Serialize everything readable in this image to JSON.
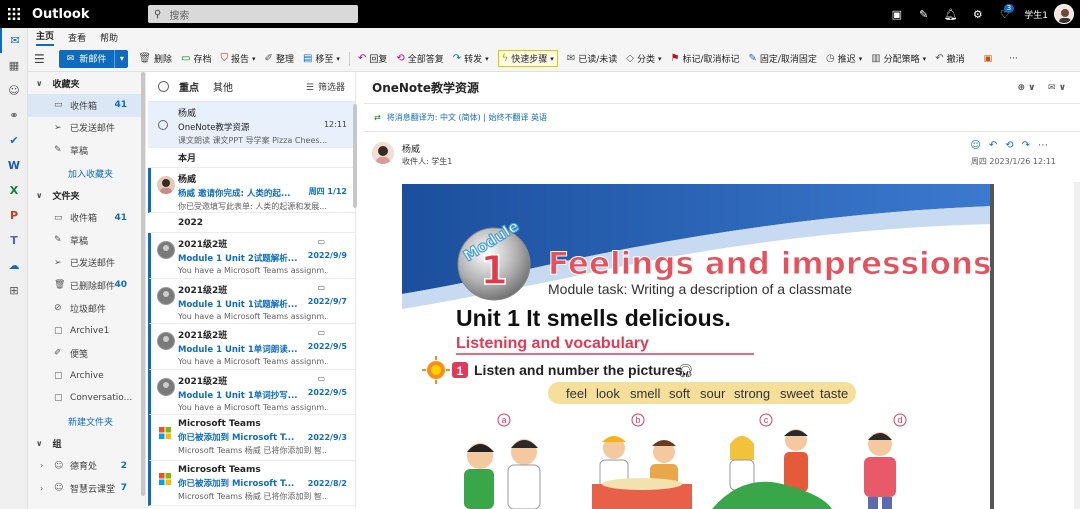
{
  "titlebar": {
    "app_name": "Outlook",
    "search_placeholder": "搜索",
    "notification_count": "3",
    "user_name": "学生1"
  },
  "ribbon": {
    "tabs": [
      "主页",
      "查看",
      "帮助"
    ],
    "new_mail": "新邮件",
    "buttons": [
      "删除",
      "存档",
      "报告",
      "整理",
      "移至",
      "回复",
      "全部答复",
      "转发",
      "快速步骤",
      "已读/未读",
      "分类",
      "标记/取消标记",
      "固定/取消固定",
      "推迟",
      "分配策略",
      "撤消"
    ]
  },
  "folders": {
    "favorites_header": "收藏夹",
    "favorites": [
      {
        "label": "收件箱",
        "count": "41"
      },
      {
        "label": "已发送邮件",
        "count": ""
      },
      {
        "label": "草稿",
        "count": ""
      }
    ],
    "add_favorite": "加入收藏夹",
    "folders_header": "文件夹",
    "folders": [
      {
        "label": "收件箱",
        "count": "41"
      },
      {
        "label": "草稿",
        "count": ""
      },
      {
        "label": "已发送邮件",
        "count": ""
      },
      {
        "label": "已删除邮件",
        "count": "40"
      },
      {
        "label": "垃圾邮件",
        "count": ""
      },
      {
        "label": "Archive1",
        "count": ""
      },
      {
        "label": "便笺",
        "count": ""
      },
      {
        "label": "Archive",
        "count": ""
      },
      {
        "label": "Conversatio...",
        "count": ""
      }
    ],
    "new_folder": "新建文件夹",
    "groups_header": "组",
    "groups": [
      {
        "label": "德育处",
        "count": "2"
      },
      {
        "label": "智慧云课堂",
        "count": "7"
      }
    ]
  },
  "message_list": {
    "tab_focused": "重点",
    "tab_other": "其他",
    "filter": "筛选器",
    "group_month": "本月",
    "group_2022": "2022",
    "messages": [
      {
        "sender": "杨威",
        "subject": "OneNote教学资源",
        "date": "12:11",
        "preview": "课文朗读 课文PPT 导学案 Pizza Chees..."
      },
      {
        "sender": "杨威",
        "subject": "杨威 邀请你完成: 人类的起...",
        "date": "周四 1/12",
        "preview": "你已受邀填写此表单: 人类的起源和发展..."
      },
      {
        "sender": "2021级2班",
        "subject": "Module 1 Unit 2试题解析...",
        "date": "2022/9/9",
        "preview": "You have a Microsoft Teams assignm..."
      },
      {
        "sender": "2021级2班",
        "subject": "Module 1 Unit 1试题解析...",
        "date": "2022/9/7",
        "preview": "You have a Microsoft Teams assignm..."
      },
      {
        "sender": "2021级2班",
        "subject": "Module 1 Unit 1单词朗读...",
        "date": "2022/9/5",
        "preview": "You have a Microsoft Teams assignm..."
      },
      {
        "sender": "2021级2班",
        "subject": "Module 1 Unit 1单词抄写...",
        "date": "2022/9/5",
        "preview": "You have a Microsoft Teams assignm..."
      },
      {
        "sender": "Microsoft Teams",
        "subject": "你已被添加到 Microsoft T...",
        "date": "2022/9/3",
        "preview": "Microsoft Teams 杨威 已将你添加到 智..."
      },
      {
        "sender": "Microsoft Teams",
        "subject": "你已被添加到 Microsoft T...",
        "date": "2022/8/2",
        "preview": "Microsoft Teams 杨威 已将你添加到 智..."
      }
    ]
  },
  "reading": {
    "subject": "OneNote教学资源",
    "translate": "将消息翻译为: 中文 (简体) | 始终不翻译 英语",
    "from": "杨威",
    "to": "收件人: 学生1",
    "datetime": "周四 2023/1/26 12:11"
  },
  "book": {
    "module_word": "Module",
    "module_num": "1",
    "title": "Feelings and impressions",
    "task": "Module task: Writing a description of a classmate",
    "unit": "Unit 1  It smells delicious.",
    "section": "Listening and vocabulary",
    "exercise_num": "1",
    "exercise": "Listen and number the pictures.",
    "words": [
      "feel",
      "look",
      "smell",
      "soft",
      "sour",
      "strong",
      "sweet",
      "taste"
    ],
    "labels": [
      "a",
      "b",
      "c",
      "d"
    ]
  }
}
